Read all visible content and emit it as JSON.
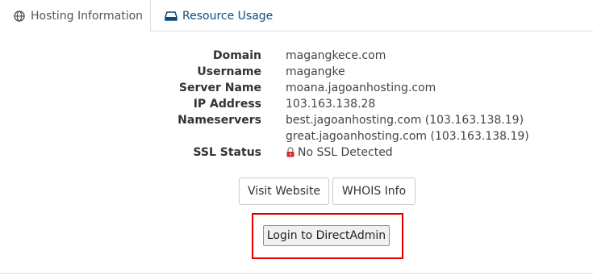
{
  "tabs": [
    {
      "label": "Hosting Information",
      "icon": "globe-icon",
      "active": true
    },
    {
      "label": "Resource Usage",
      "icon": "hard-drive-icon",
      "active": false
    }
  ],
  "info": {
    "domain_label": "Domain",
    "domain_value": "magangkece.com",
    "username_label": "Username",
    "username_value": "magangke",
    "server_name_label": "Server Name",
    "server_name_value": "moana.jagoanhosting.com",
    "ip_address_label": "IP Address",
    "ip_address_value": "103.163.138.28",
    "nameservers_label": "Nameservers",
    "nameservers_values": [
      "best.jagoanhosting.com (103.163.138.19)",
      "great.jagoanhosting.com (103.163.138.19)"
    ],
    "ssl_status_label": "SSL Status",
    "ssl_status_value": "No SSL Detected",
    "ssl_icon": "lock-icon"
  },
  "buttons": {
    "visit_website": "Visit Website",
    "whois_info": "WHOIS Info",
    "login_directadmin": "Login to DirectAdmin"
  },
  "colors": {
    "accent_link": "#0e4b7c",
    "highlight_border": "#e00000",
    "lock_red": "#d9282f"
  }
}
